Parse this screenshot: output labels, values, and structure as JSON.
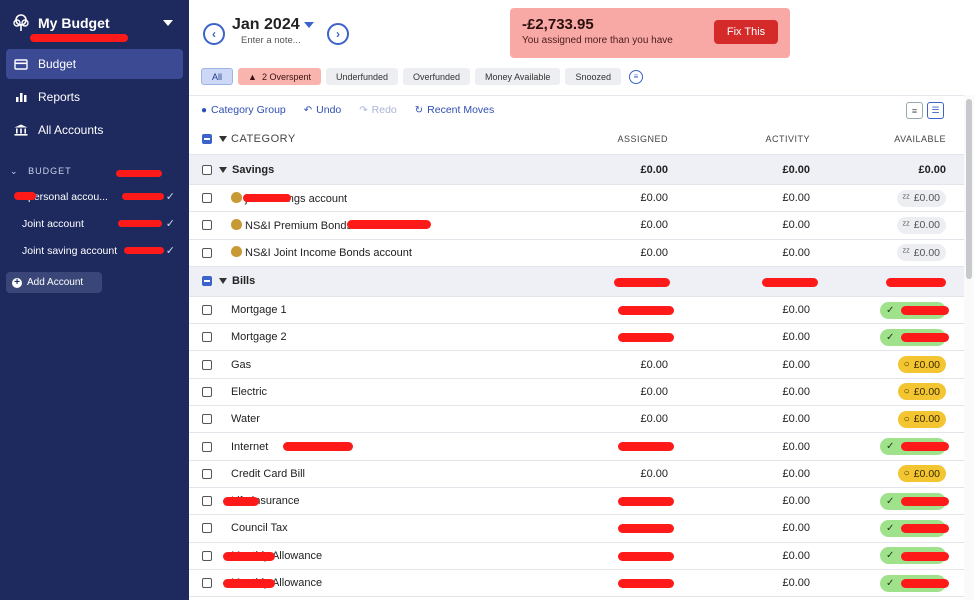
{
  "sidebar": {
    "budget_name": "My Budget",
    "nav": [
      {
        "label": "Budget",
        "icon": "bank-card-icon",
        "active": true
      },
      {
        "label": "Reports",
        "icon": "bar-chart-icon",
        "active": false
      },
      {
        "label": "All Accounts",
        "icon": "bank-icon",
        "active": false
      }
    ],
    "section_label": "BUDGET",
    "accounts": [
      {
        "label": "personal accou..."
      },
      {
        "label": "Joint account"
      },
      {
        "label": "Joint saving account"
      }
    ],
    "add_account_label": "Add Account"
  },
  "header": {
    "month": "Jan 2024",
    "note_placeholder": "Enter a note...",
    "prev_icon": "chevron-left-icon",
    "next_icon": "chevron-right-icon"
  },
  "alert": {
    "amount": "-£2,733.95",
    "message": "You assigned more than you have",
    "fix_label": "Fix This"
  },
  "filters": {
    "all": "All",
    "overspent": "2 Overspent",
    "underfunded": "Underfunded",
    "overfunded": "Overfunded",
    "money_available": "Money Available",
    "snoozed": "Snoozed"
  },
  "toolbar": {
    "category_group": "Category Group",
    "undo": "Undo",
    "redo": "Redo",
    "recent_moves": "Recent Moves"
  },
  "columns": {
    "category": "CATEGORY",
    "assigned": "ASSIGNED",
    "activity": "ACTIVITY",
    "available": "AVAILABLE"
  },
  "groups": {
    "savings": {
      "name": "Savings",
      "assigned": "£0.00",
      "activity": "£0.00",
      "available": "£0.00"
    },
    "bills": {
      "name": "Bills"
    }
  },
  "savings_rows": [
    {
      "name": "joint savings account",
      "assigned": "£0.00",
      "activity": "£0.00",
      "available": "£0.00"
    },
    {
      "name": "NS&I Premium Bonds",
      "assigned": "£0.00",
      "activity": "£0.00",
      "available": "£0.00"
    },
    {
      "name": "NS&I Joint Income Bonds account",
      "assigned": "£0.00",
      "activity": "£0.00",
      "available": "£0.00"
    }
  ],
  "bills_rows": [
    {
      "name": "Mortgage 1",
      "assigned": "",
      "activity": "£0.00",
      "available": "",
      "status": "green"
    },
    {
      "name": "Mortgage 2",
      "assigned": "",
      "activity": "£0.00",
      "available": "",
      "status": "green"
    },
    {
      "name": "Gas",
      "assigned": "£0.00",
      "activity": "£0.00",
      "available": "£0.00",
      "status": "yellow"
    },
    {
      "name": "Electric",
      "assigned": "£0.00",
      "activity": "£0.00",
      "available": "£0.00",
      "status": "yellow"
    },
    {
      "name": "Water",
      "assigned": "£0.00",
      "activity": "£0.00",
      "available": "£0.00",
      "status": "yellow"
    },
    {
      "name": "Internet",
      "assigned": "",
      "activity": "£0.00",
      "available": "",
      "status": "green"
    },
    {
      "name": "Credit Card Bill",
      "assigned": "£0.00",
      "activity": "£0.00",
      "available": "£0.00",
      "status": "yellow"
    },
    {
      "name": "Life insurance",
      "assigned": "",
      "activity": "£0.00",
      "available": "",
      "status": "green"
    },
    {
      "name": "Council Tax",
      "assigned": "",
      "activity": "£0.00",
      "available": "",
      "status": "green"
    },
    {
      "name": "Monthly Allowance",
      "assigned": "",
      "activity": "£0.00",
      "available": "",
      "status": "green"
    },
    {
      "name": "Monthly Allowance",
      "assigned": "",
      "activity": "£0.00",
      "available": "",
      "status": "green"
    }
  ],
  "colors": {
    "sidebar_bg": "#1e2a5e",
    "accent": "#3b63c9",
    "alert_bg": "#f9a9a5",
    "fix_button": "#d42a2a",
    "pill_green": "#9fe28b",
    "pill_yellow": "#f3c531",
    "redaction": "#ff1a1a"
  }
}
